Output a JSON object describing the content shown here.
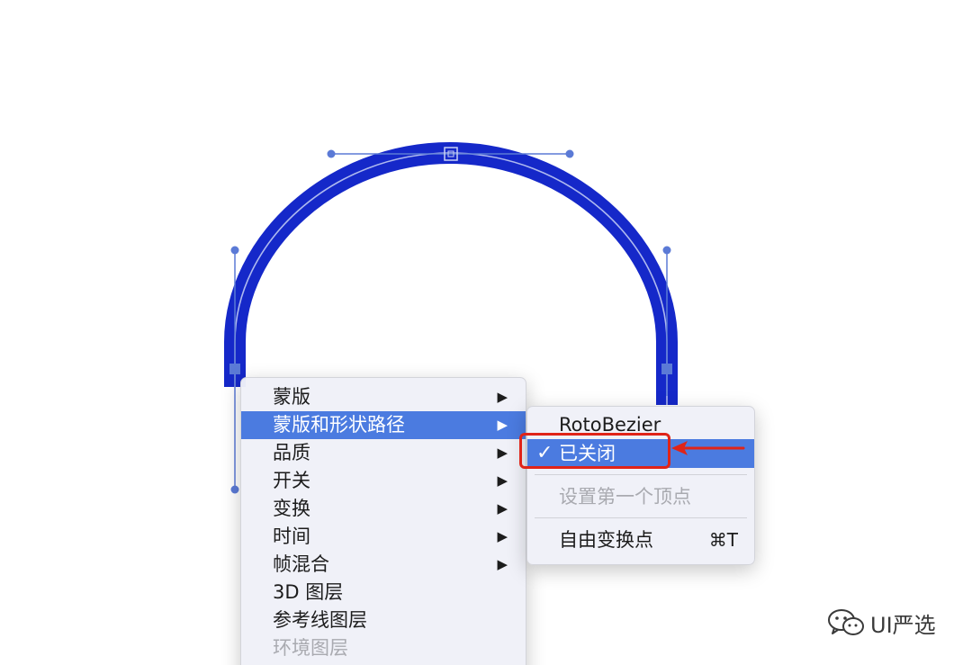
{
  "main_menu": {
    "items": [
      {
        "label": "蒙版",
        "has_submenu": true,
        "highlighted": false,
        "disabled": false
      },
      {
        "label": "蒙版和形状路径",
        "has_submenu": true,
        "highlighted": true,
        "disabled": false
      },
      {
        "label": "品质",
        "has_submenu": true,
        "highlighted": false,
        "disabled": false
      },
      {
        "label": "开关",
        "has_submenu": true,
        "highlighted": false,
        "disabled": false
      },
      {
        "label": "变换",
        "has_submenu": true,
        "highlighted": false,
        "disabled": false
      },
      {
        "label": "时间",
        "has_submenu": true,
        "highlighted": false,
        "disabled": false
      },
      {
        "label": "帧混合",
        "has_submenu": true,
        "highlighted": false,
        "disabled": false
      },
      {
        "label": "3D 图层",
        "has_submenu": false,
        "highlighted": false,
        "disabled": false
      },
      {
        "label": "参考线图层",
        "has_submenu": false,
        "highlighted": false,
        "disabled": false
      },
      {
        "label": "环境图层",
        "has_submenu": false,
        "highlighted": false,
        "disabled": true
      }
    ],
    "submenu_arrow": "▶"
  },
  "sub_menu": {
    "items": {
      "rotobezier": {
        "label": "RotoBezier"
      },
      "closed": {
        "label": "已关闭",
        "checked": true,
        "check_glyph": "✓"
      },
      "set_first_vertex": {
        "label": "设置第一个顶点",
        "disabled": true
      },
      "free_transform": {
        "label": "自由变换点",
        "shortcut": "⌘T"
      }
    }
  },
  "colors": {
    "stroke_blue": "#1528c9",
    "path_handle": "#5b7ad6",
    "highlight": "#4b7be0",
    "callout_red": "#e02418"
  },
  "watermark": {
    "icon": "wechat-icon",
    "text": "UI严选"
  }
}
